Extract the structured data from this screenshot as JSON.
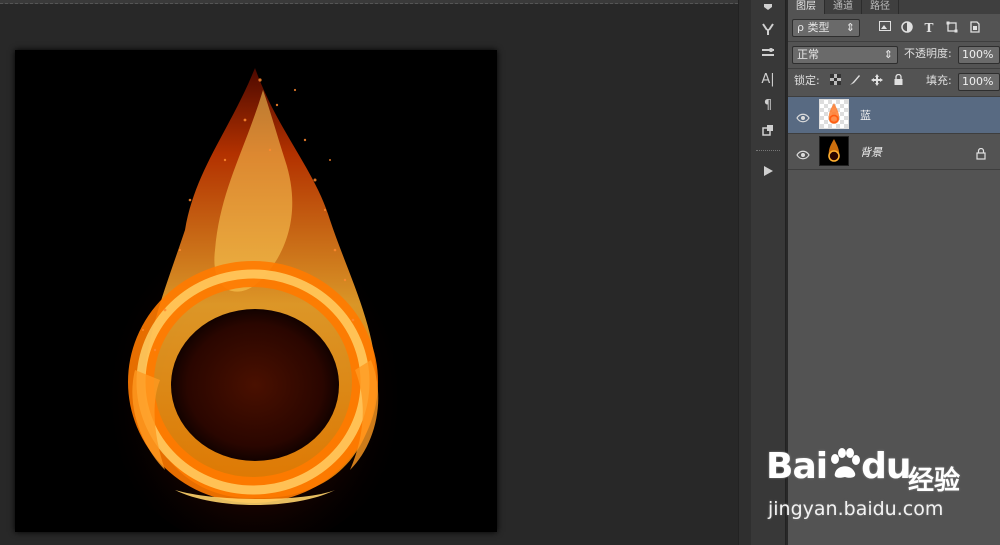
{
  "layers_panel": {
    "tabs": [
      {
        "label": "图层",
        "active": true
      },
      {
        "label": "通道",
        "active": false
      },
      {
        "label": "路径",
        "active": false
      }
    ],
    "filter_kind": "ρ 类型",
    "filter_icons": [
      "image-filter-icon",
      "adjustment-filter-icon",
      "type-filter-icon",
      "shape-filter-icon",
      "smart-object-filter-icon"
    ],
    "blend_mode": "正常",
    "opacity_label": "不透明度:",
    "opacity_value": "100%",
    "lock_label": "锁定:",
    "lock_icons": [
      "lock-transparent-icon",
      "lock-brush-icon",
      "lock-move-icon",
      "lock-all-icon"
    ],
    "fill_label": "填充:",
    "fill_value": "100%",
    "layers": [
      {
        "name": "蓝",
        "selected": true,
        "visible": true,
        "locked": false,
        "italic": false
      },
      {
        "name": "背景",
        "selected": false,
        "visible": true,
        "locked": true,
        "italic": true
      }
    ]
  },
  "toolstrip": {
    "icons": [
      "brush-settings-icon",
      "tool-presets-icon",
      "character-icon",
      "paragraph-icon",
      "3d-icon",
      "play-actions-icon"
    ],
    "character_glyph": "A|",
    "paragraph_glyph": "¶"
  },
  "canvas": {
    "description_colors": {
      "background": "#000000",
      "flame_outer": "#ff6a00",
      "flame_core": "#ffd24a"
    }
  },
  "watermark": {
    "brand_bai": "Bai",
    "brand_du": "du",
    "suffix": "经验",
    "url": "jingyan.baidu.com"
  }
}
